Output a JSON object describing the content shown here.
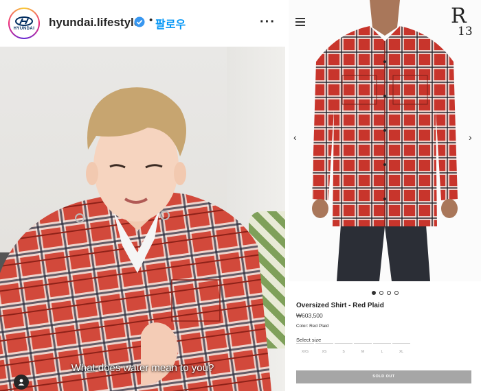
{
  "instagram": {
    "username": "hyundai.lifestyle",
    "separator": "•",
    "follow_label": "팔로우",
    "more_icon": "more-dots-icon",
    "avatar_brand": "HYUNDAI",
    "caption": "What does water mean to you?",
    "verified_color": "#3897f0",
    "follow_color": "#0095f6"
  },
  "shop": {
    "brand_logo": {
      "letter": "R",
      "number": "13"
    },
    "menu_icon": "hamburger-icon",
    "product_title": "Oversized Shirt - Red Plaid",
    "price": "₩603,500",
    "color_label": "Color: Red Plaid",
    "select_size_label": "Select size",
    "sizes": [
      "XXS",
      "XS",
      "S",
      "M",
      "L",
      "XL"
    ],
    "carousel": {
      "total": 4,
      "active": 1
    },
    "sold_out_label": "SOLD OUT",
    "accent_red": "#c8352c"
  }
}
